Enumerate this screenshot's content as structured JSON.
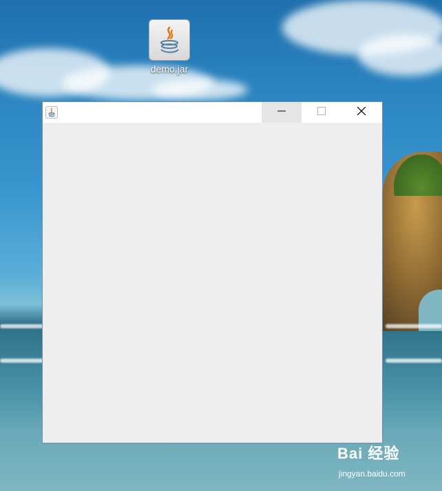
{
  "desktop": {
    "icons": [
      {
        "label": "demo.jar",
        "icon": "java-cup-icon"
      }
    ]
  },
  "window": {
    "icon": "java-cup-icon",
    "controls": {
      "minimize": "minimize-icon",
      "maximize": "maximize-icon",
      "close": "close-icon"
    },
    "background_color": "#eeeeee",
    "titlebar_color": "#ffffff"
  },
  "watermark": {
    "brand_text": "Bai 经验",
    "url": "jingyan.baidu.com"
  }
}
